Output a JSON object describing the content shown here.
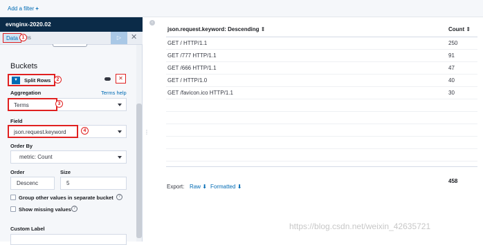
{
  "filter_bar": {
    "add_filter_label": "Add a filter",
    "plus_glyph": "+"
  },
  "sidebar": {
    "index_name": "evnginx-2020.02",
    "tabs": {
      "data": "Data",
      "options": "tions"
    },
    "run_glyph": "▷",
    "close_glyph": "✕",
    "buckets_title": "Buckets",
    "split_rows_label": "Split Rows",
    "remove_glyph": "✕",
    "aggregation_label": "Aggregation",
    "terms_help_label": "Terms help",
    "aggregation_value": "Terms",
    "field_label": "Field",
    "field_value": "json.request.keyword",
    "order_by_label": "Order By",
    "order_by_value": "metric: Count",
    "order_label": "Order",
    "order_value": "Descenc",
    "size_label": "Size",
    "size_value": "5",
    "group_other_label": "Group other values in separate bucket",
    "show_missing_label": "Show missing values",
    "custom_label_label": "Custom Label",
    "help_glyph": "?",
    "annotations": [
      "1",
      "2",
      "3",
      "4"
    ]
  },
  "table": {
    "columns": [
      "json.request.keyword: Descending ⇕",
      "Count ⇕"
    ],
    "rows": [
      {
        "request": "GET / HTTP/1.1",
        "count": "250"
      },
      {
        "request": "GET /777 HTTP/1.1",
        "count": "91"
      },
      {
        "request": "GET /666 HTTP/1.1",
        "count": "47"
      },
      {
        "request": "GET / HTTP/1.0",
        "count": "40"
      },
      {
        "request": "GET /favicon.ico HTTP/1.1",
        "count": "30"
      }
    ],
    "total": "458"
  },
  "export": {
    "label": "Export:",
    "raw": "Raw",
    "formatted": "Formatted",
    "download_glyph": "⬇"
  },
  "watermark": "https://blog.csdn.net/weixin_42635721",
  "colors": {
    "accent": "#006bb4",
    "header_bg": "#0b2b48",
    "annotation": "#e02020"
  }
}
